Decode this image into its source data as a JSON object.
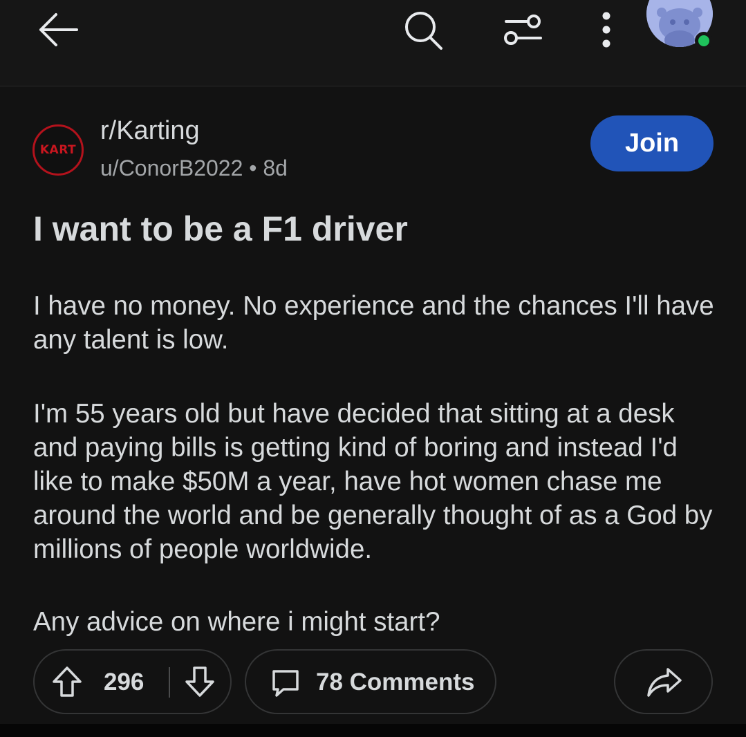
{
  "header": {
    "icons": [
      "back-arrow-icon",
      "search-icon",
      "filter-icon",
      "more-vertical-icon",
      "avatar"
    ],
    "online_status_color": "#1fc25b"
  },
  "post": {
    "subreddit": "r/Karting",
    "subreddit_icon_text": "KART",
    "author": "u/ConorB2022",
    "separator": "•",
    "age": "8d",
    "join_label": "Join",
    "title": "I want to be a F1 driver",
    "body": [
      "I have no money. No experience and the chances I'll have any talent is low.",
      "I'm 55 years old but have decided that sitting at a desk and paying bills is getting kind of boring and instead I'd like to make $50M a year, have hot women chase me around the world and be generally thought of as a God by millions of people worldwide.",
      "Any advice on where i might start?"
    ]
  },
  "actions": {
    "score": "296",
    "comments_label": "78 Comments"
  },
  "colors": {
    "background": "#121212",
    "join_button": "#2154b8",
    "subreddit_icon_border": "#b3121c",
    "text": "#d7dadc",
    "muted_text": "#a3a6a9"
  }
}
